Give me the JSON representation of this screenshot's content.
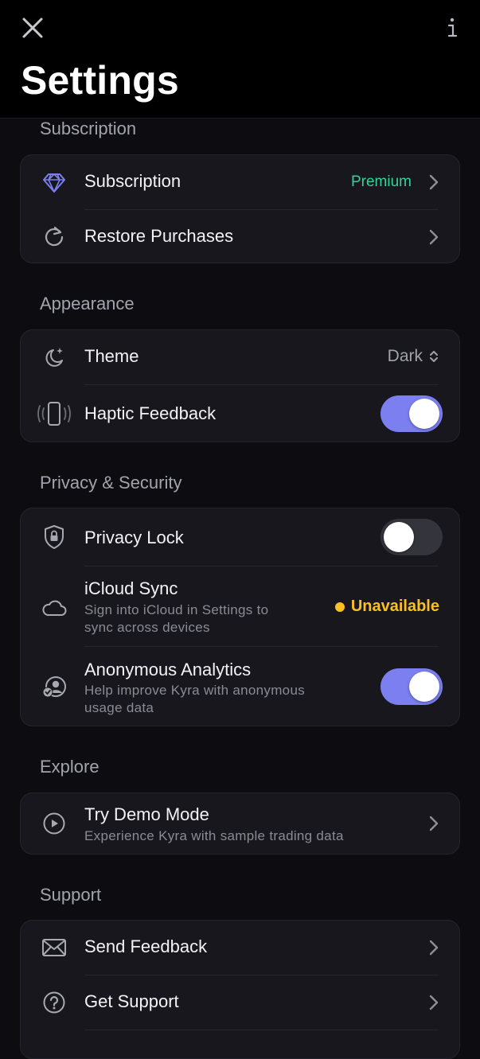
{
  "header": {
    "title": "Settings",
    "close_icon": "close-icon",
    "info_icon": "info-icon"
  },
  "sections": {
    "subscription": {
      "label": "Subscription",
      "rows": {
        "subscription": {
          "label": "Subscription",
          "value": "Premium",
          "icon": "diamond-icon"
        },
        "restore": {
          "label": "Restore Purchases",
          "icon": "restore-icon"
        }
      }
    },
    "appearance": {
      "label": "Appearance",
      "rows": {
        "theme": {
          "label": "Theme",
          "value": "Dark",
          "icon": "moon-sparkle-icon"
        },
        "haptic": {
          "label": "Haptic Feedback",
          "icon": "phone-vibrate-icon",
          "enabled": true
        }
      }
    },
    "privacy": {
      "label": "Privacy & Security",
      "rows": {
        "lock": {
          "label": "Privacy Lock",
          "icon": "shield-lock-icon",
          "enabled": false
        },
        "icloud": {
          "label": "iCloud Sync",
          "subtitle_line1": "Sign into iCloud in Settings to",
          "subtitle_line2": "sync across devices",
          "status": "Unavailable",
          "icon": "cloud-icon"
        },
        "analytics": {
          "label": "Anonymous Analytics",
          "subtitle_line1": "Help improve Kyra with anonymous",
          "subtitle_line2": "usage data",
          "icon": "person-check-icon",
          "enabled": true
        }
      }
    },
    "explore": {
      "label": "Explore",
      "rows": {
        "demo": {
          "label": "Try Demo Mode",
          "subtitle": "Experience Kyra with sample trading data",
          "icon": "play-circle-icon"
        }
      }
    },
    "support": {
      "label": "Support",
      "rows": {
        "feedback": {
          "label": "Send Feedback",
          "icon": "envelope-icon"
        },
        "help": {
          "label": "Get Support",
          "icon": "question-circle-icon"
        }
      }
    }
  },
  "colors": {
    "accent": "#7c7ff0",
    "premium": "#34d399",
    "warning": "#fbbf24",
    "card": "#17171d",
    "background": "#0d0d11"
  }
}
